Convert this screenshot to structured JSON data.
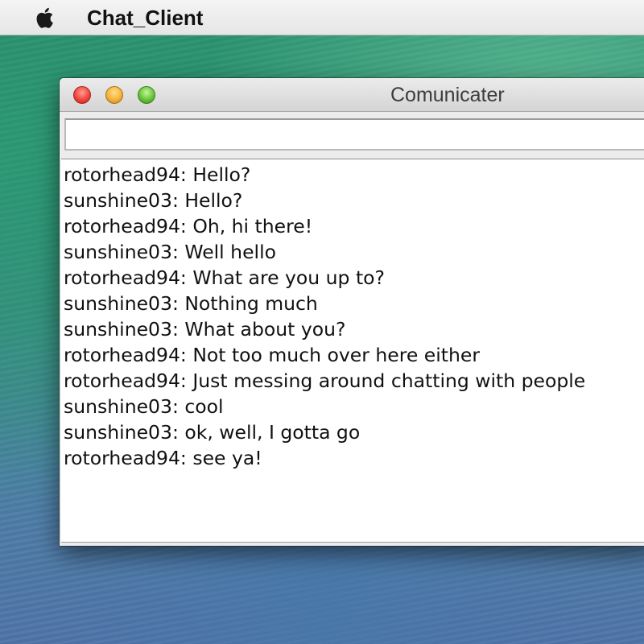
{
  "menubar": {
    "apple_icon": "apple-logo-icon",
    "app_name": "Chat_Client"
  },
  "window": {
    "title": "Comunicater",
    "controls": {
      "close_icon": "close-icon",
      "minimize_icon": "minimize-icon",
      "maximize_icon": "maximize-icon"
    },
    "message_input": {
      "value": "",
      "placeholder": ""
    },
    "chat_log": [
      "rotorhead94: Hello?",
      "sunshine03: Hello?",
      "rotorhead94: Oh, hi there!",
      "sunshine03: Well hello",
      "rotorhead94: What are you up to?",
      "sunshine03: Nothing much",
      "sunshine03: What about you?",
      "rotorhead94: Not too much over here either",
      "rotorhead94: Just messing around chatting with people",
      "sunshine03: cool",
      "sunshine03: ok, well, I gotta go",
      "rotorhead94: see ya!"
    ]
  },
  "colors": {
    "close": "#f2453d",
    "minimize": "#f6b23a",
    "maximize": "#67c43a",
    "desktop_top": "#2a8f6e",
    "desktop_bottom": "#4f74a8"
  }
}
